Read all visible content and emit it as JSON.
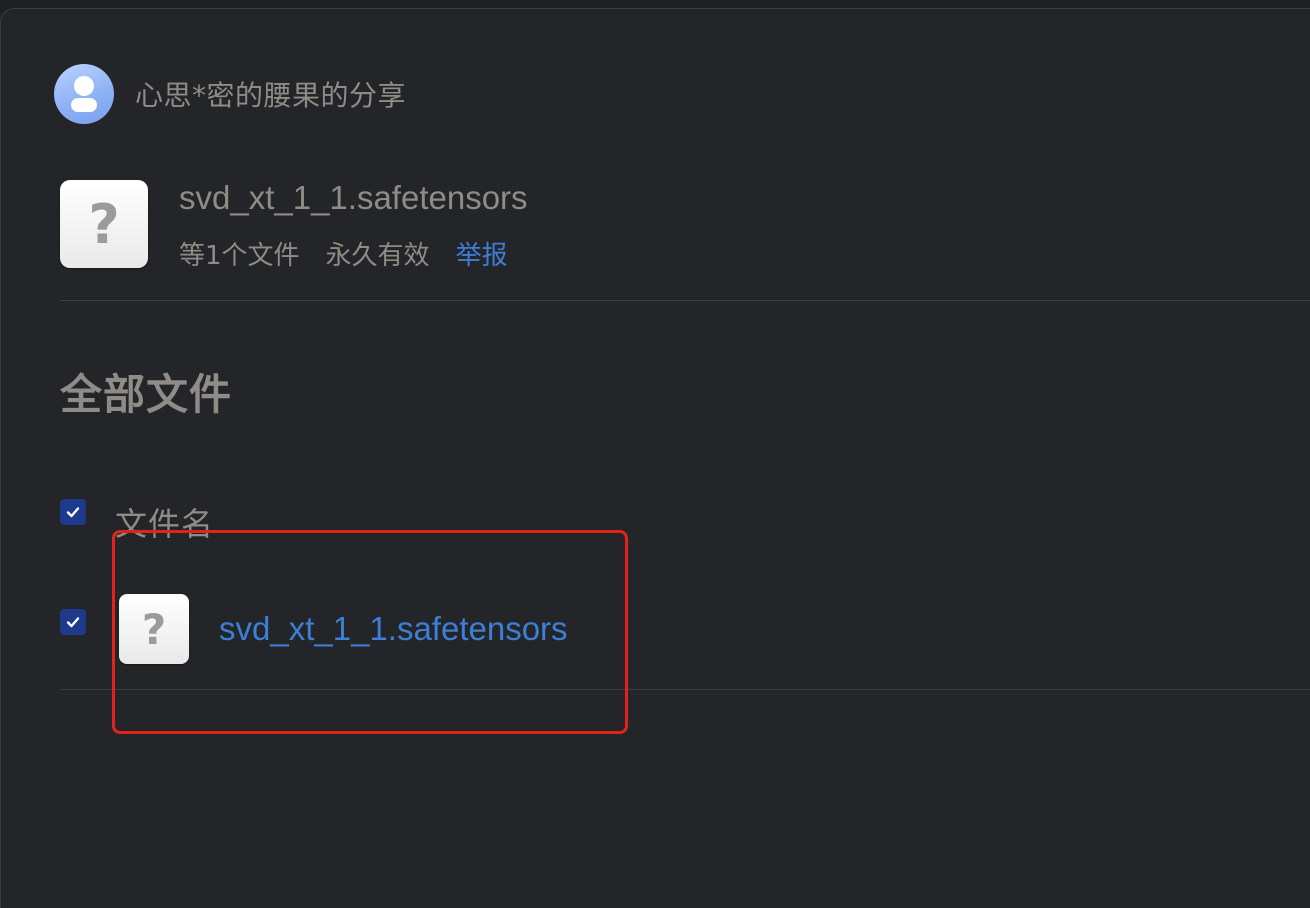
{
  "sharer": {
    "name": "心思*密的腰果的分享",
    "avatar_icon": "user-avatar-icon"
  },
  "share": {
    "title": "svd_xt_1_1.safetensors",
    "file_count": "等1个文件",
    "validity": "永久有效",
    "report_label": "举报",
    "icon": "unknown-file-icon",
    "icon_glyph": "?"
  },
  "files": {
    "section_title": "全部文件",
    "column_header": "文件名",
    "header_checked": true,
    "rows": [
      {
        "name": "svd_xt_1_1.safetensors",
        "checked": true,
        "icon_glyph": "?"
      }
    ]
  },
  "colors": {
    "background": "#242528",
    "text": "#8f8b86",
    "link": "#3d7fd6",
    "checkbox": "#1e3a8c",
    "annotation": "#e0241b"
  }
}
